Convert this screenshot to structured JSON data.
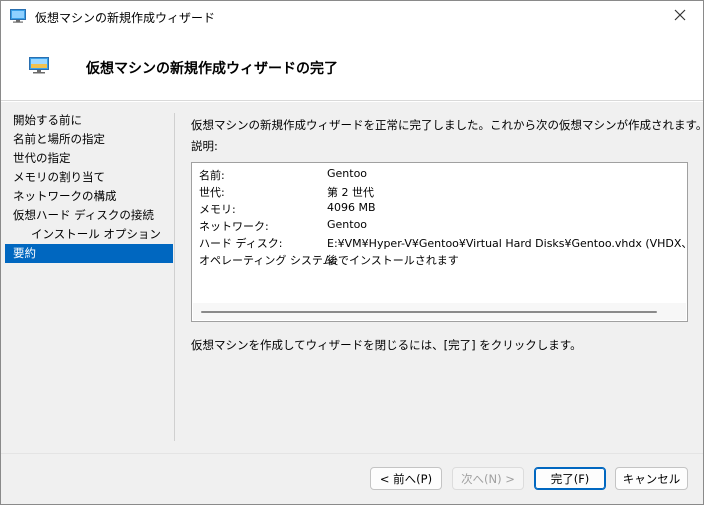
{
  "window": {
    "title": "仮想マシンの新規作成ウィザード",
    "close_glyph": "✕"
  },
  "header": {
    "title": "仮想マシンの新規作成ウィザードの完了"
  },
  "nav": {
    "items": [
      {
        "label": "開始する前に"
      },
      {
        "label": "名前と場所の指定"
      },
      {
        "label": "世代の指定"
      },
      {
        "label": "メモリの割り当て"
      },
      {
        "label": "ネットワークの構成"
      },
      {
        "label": "仮想ハード ディスクの接続"
      },
      {
        "label": "インストール オプション"
      },
      {
        "label": "要約"
      }
    ],
    "active_index": 7
  },
  "main": {
    "intro": "仮想マシンの新規作成ウィザードを正常に完了しました。これから次の仮想マシンが作成されます。",
    "description_label": "説明:",
    "summary": [
      {
        "key": "名前:",
        "value": "Gentoo"
      },
      {
        "key": "世代:",
        "value": "第 2 世代"
      },
      {
        "key": "メモリ:",
        "value": "4096 MB"
      },
      {
        "key": "ネットワーク:",
        "value": "Gentoo"
      },
      {
        "key": "ハード ディスク:",
        "value": "E:¥VM¥Hyper-V¥Gentoo¥Virtual Hard Disks¥Gentoo.vhdx (VHDX、容量可変"
      },
      {
        "key": "オペレーティング システム:",
        "value": "後でインストールされます"
      }
    ],
    "finish_text": "仮想マシンを作成してウィザードを閉じるには、[完了] をクリックします。"
  },
  "buttons": {
    "prev": "< 前へ(P)",
    "next": "次へ(N) >",
    "finish": "完了(F)",
    "cancel": "キャンセル"
  },
  "colors": {
    "accent": "#0067c0",
    "panel_bg": "#f0f0f0"
  },
  "icons": {
    "app": "vm-monitor-icon",
    "header": "vm-monitor-icon",
    "close": "close-icon"
  }
}
